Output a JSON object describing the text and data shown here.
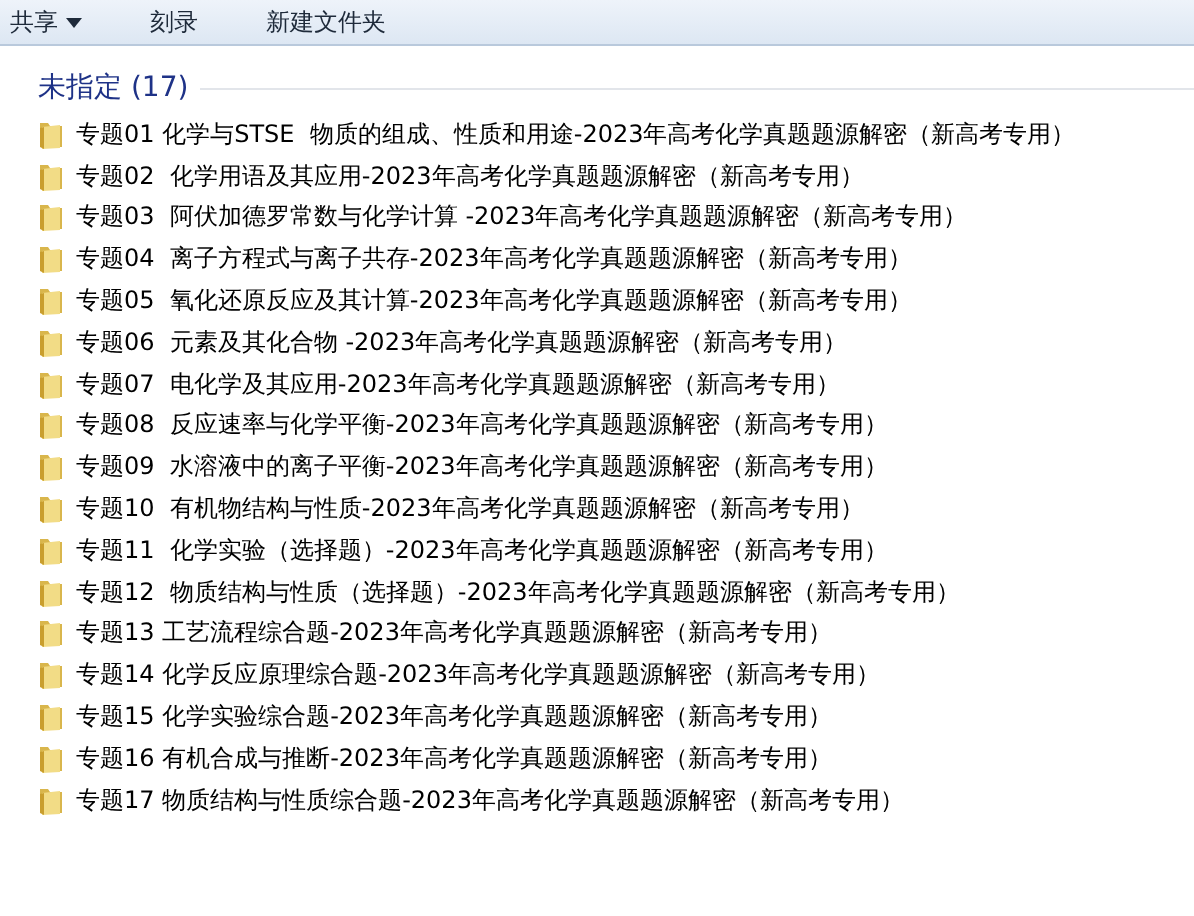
{
  "toolbar": {
    "items": [
      {
        "label": "共享",
        "kind": "dropdown"
      },
      {
        "label": "刻录",
        "kind": "plain"
      },
      {
        "label": "新建文件夹",
        "kind": "plain"
      }
    ]
  },
  "group": {
    "title": "未指定 (17)",
    "items": [
      {
        "name": "专题01 化学与STSE  物质的组成、性质和用途-2023年高考化学真题题源解密（新高考专用）"
      },
      {
        "name": "专题02  化学用语及其应用-2023年高考化学真题题源解密（新高考专用）"
      },
      {
        "name": "专题03  阿伏加德罗常数与化学计算 -2023年高考化学真题题源解密（新高考专用）"
      },
      {
        "name": "专题04  离子方程式与离子共存-2023年高考化学真题题源解密（新高考专用）"
      },
      {
        "name": "专题05  氧化还原反应及其计算-2023年高考化学真题题源解密（新高考专用）"
      },
      {
        "name": "专题06  元素及其化合物 -2023年高考化学真题题源解密（新高考专用）"
      },
      {
        "name": "专题07  电化学及其应用-2023年高考化学真题题源解密（新高考专用）"
      },
      {
        "name": "专题08  反应速率与化学平衡-2023年高考化学真题题源解密（新高考专用）"
      },
      {
        "name": "专题09  水溶液中的离子平衡-2023年高考化学真题题源解密（新高考专用）"
      },
      {
        "name": "专题10  有机物结构与性质-2023年高考化学真题题源解密（新高考专用）"
      },
      {
        "name": "专题11  化学实验（选择题）-2023年高考化学真题题源解密（新高考专用）"
      },
      {
        "name": "专题12  物质结构与性质（选择题）-2023年高考化学真题题源解密（新高考专用）"
      },
      {
        "name": "专题13 工艺流程综合题-2023年高考化学真题题源解密（新高考专用）"
      },
      {
        "name": "专题14 化学反应原理综合题-2023年高考化学真题题源解密（新高考专用）"
      },
      {
        "name": "专题15 化学实验综合题-2023年高考化学真题题源解密（新高考专用）"
      },
      {
        "name": "专题16 有机合成与推断-2023年高考化学真题题源解密（新高考专用）"
      },
      {
        "name": "专题17 物质结构与性质综合题-2023年高考化学真题题源解密（新高考专用）"
      }
    ]
  }
}
